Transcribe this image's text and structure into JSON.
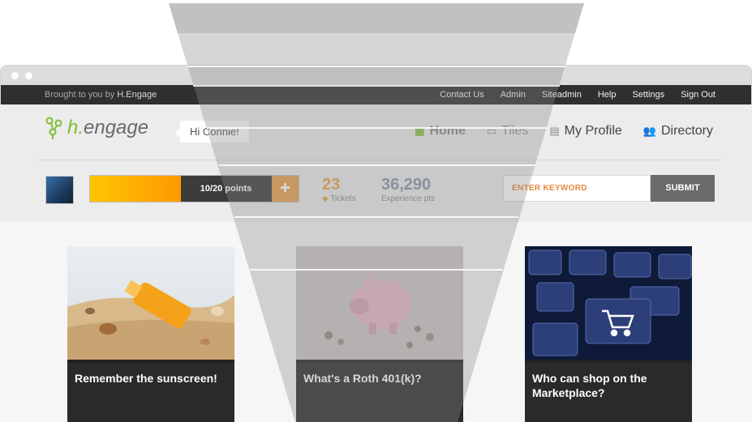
{
  "window": {
    "controls": [
      "close",
      "minimize"
    ]
  },
  "topbar": {
    "brought_prefix": "Brought to you by",
    "brand": "H.Engage",
    "links": [
      "Contact Us",
      "Admin",
      "Siteadmin",
      "Help",
      "Settings",
      "Sign Out"
    ]
  },
  "header": {
    "logo_text": "h.engage",
    "greeting": "Hi Connie!",
    "nav": [
      {
        "label": "Home",
        "icon": "grid-icon",
        "active": true
      },
      {
        "label": "Tiles",
        "icon": "tiles-icon",
        "active": false
      },
      {
        "label": "My Profile",
        "icon": "profile-card-icon",
        "active": false
      },
      {
        "label": "Directory",
        "icon": "people-icon",
        "active": false
      }
    ]
  },
  "status": {
    "progress_text": "10/20 points",
    "progress_fraction": 0.5,
    "tickets_value": "23",
    "tickets_label": "Tickets",
    "experience_value": "36,290",
    "experience_label": "Experience pts"
  },
  "search": {
    "placeholder": "ENTER KEYWORD",
    "submit_label": "SUBMIT"
  },
  "tiles": [
    {
      "caption": "Remember the sunscreen!",
      "image": "sunscreen-tube-in-sand"
    },
    {
      "caption": "What's a Roth 401(k)?",
      "image": "pink-piggy-bank-with-coins"
    },
    {
      "caption": "Who can shop on the Marketplace?",
      "image": "keyboard-with-cart-key"
    }
  ],
  "colors": {
    "accent_green": "#7cbf34",
    "progress_orange": "#ff9a00",
    "topbar": "#2f2f2f"
  }
}
